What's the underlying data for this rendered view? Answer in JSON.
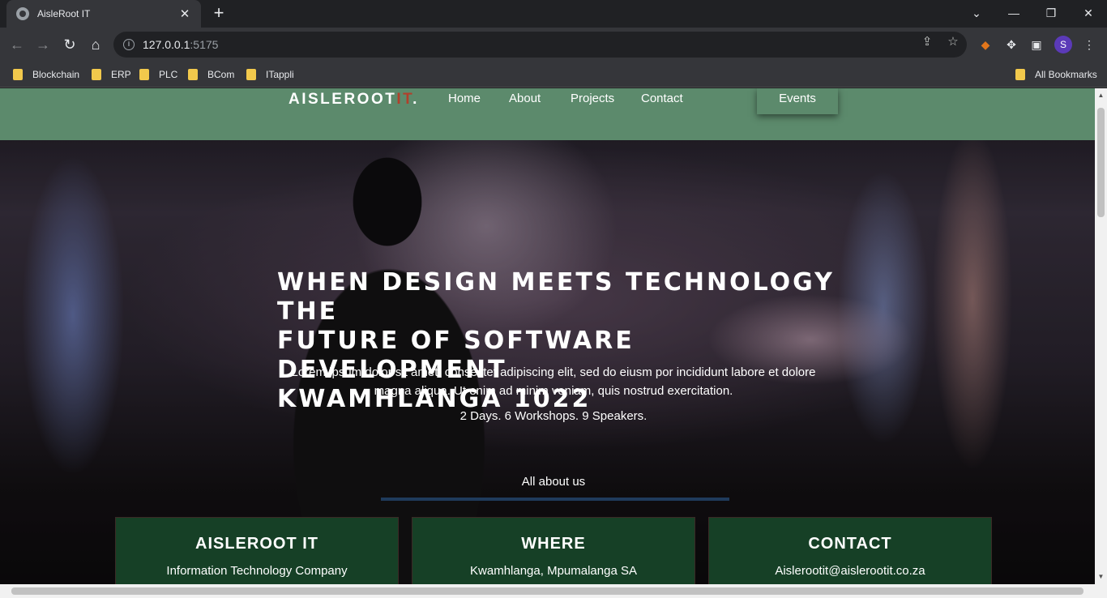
{
  "browser": {
    "tab_title": "AisleRoot IT",
    "url_host": "127.0.0.1",
    "url_port": ":5175",
    "profile_initial": "S",
    "bookmarks": [
      "Blockchain",
      "ERP",
      "PLC",
      "BCom",
      "ITappli"
    ],
    "all_bookmarks": "All Bookmarks"
  },
  "site": {
    "logo_main": "AISLEROOT",
    "logo_accent": "IT",
    "logo_dot": ".",
    "nav": [
      "Home",
      "About",
      "Projects",
      "Contact"
    ],
    "events": "Events"
  },
  "hero": {
    "headline": [
      "WHEN DESIGN MEETS TECHNOLOGY THE",
      "FUTURE OF SOFTWARE DEVELOPMENT",
      "KWAMHLANGA 1022"
    ],
    "lead": "Lorem ipsum dolor sit amet, consectet adipiscing elit, sed do eiusm por incididunt labore et dolore magna aliqua. Ut enim ad minim veniam, quis nostrud exercitation.",
    "sub": "2 Days. 6 Workshops. 9 Speakers.",
    "about_heading": "All about us"
  },
  "cards": [
    {
      "title": "AISLEROOT IT",
      "subtitle": "Information Technology Company"
    },
    {
      "title": "WHERE",
      "subtitle": "Kwamhlanga, Mpumalanga SA"
    },
    {
      "title": "CONTACT",
      "subtitle": "Aislerootit@aislerootit.co.za"
    }
  ],
  "colors": {
    "navbar": "#5c8a6c",
    "logo_accent": "#b1402b",
    "card_bg": "#18482a"
  }
}
